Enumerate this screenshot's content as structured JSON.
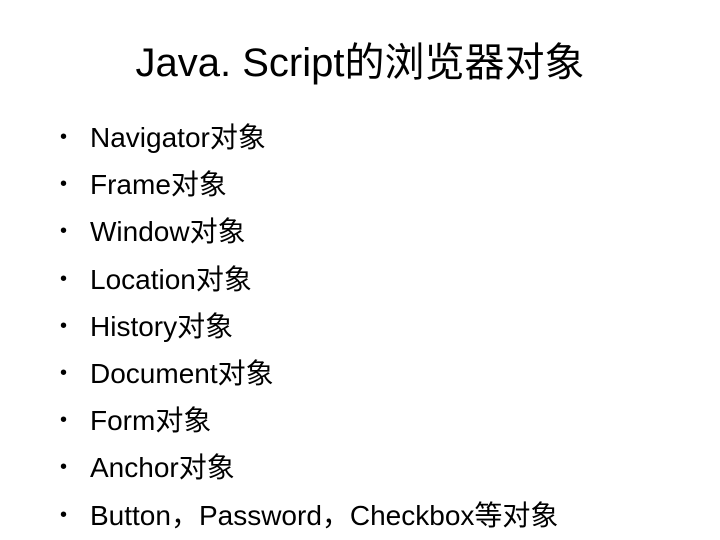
{
  "title": "Java. Script的浏览器对象",
  "bullets": [
    "Navigator对象",
    "Frame对象",
    "Window对象",
    "Location对象",
    "History对象",
    "Document对象",
    "Form对象",
    "Anchor对象",
    "Button，Password，Checkbox等对象"
  ],
  "bullet_char": "•"
}
